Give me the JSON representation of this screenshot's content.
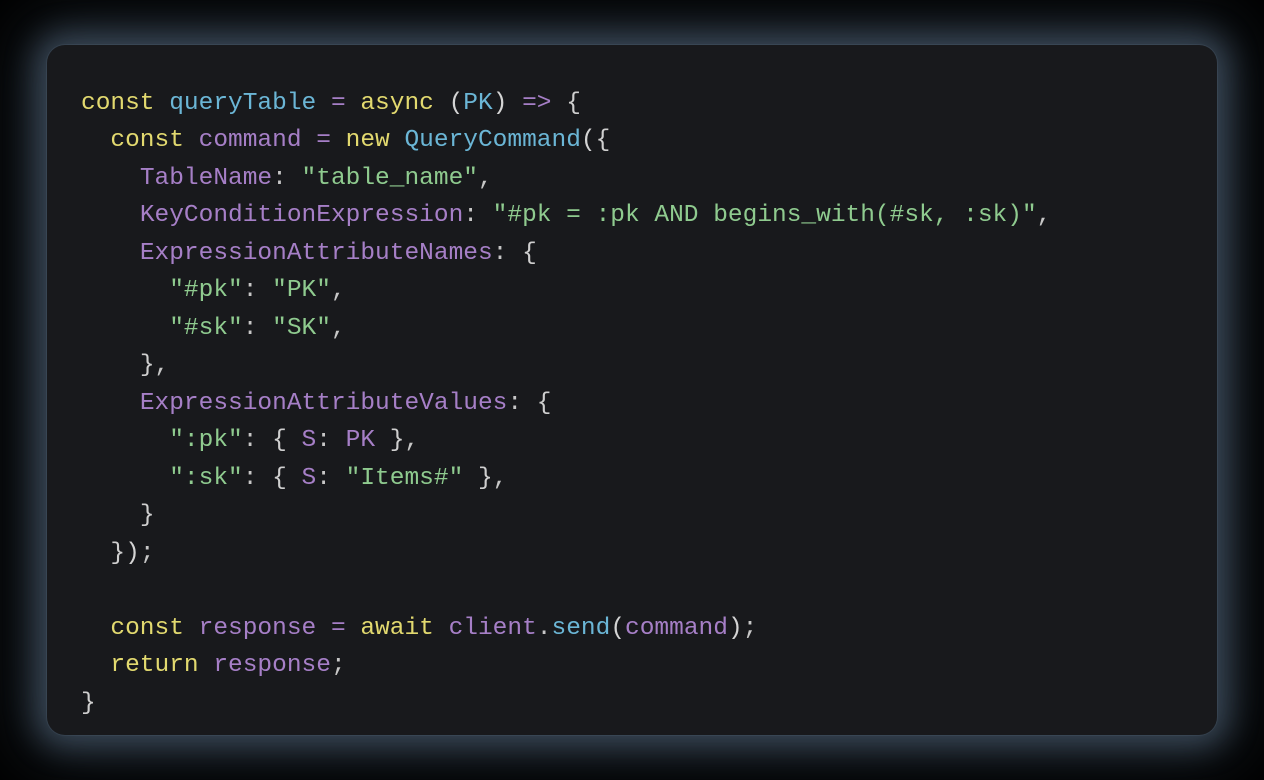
{
  "code": {
    "kw_const": "const",
    "fn_name": "queryTable",
    "eq": "=",
    "kw_async": "async",
    "lparen": "(",
    "param_pk": "PK",
    "rparen": ")",
    "arrow": "=>",
    "lbrace": "{",
    "rbrace": "}",
    "kw_const2": "const",
    "var_command": "command",
    "eq2": "=",
    "kw_new": "new",
    "type_querycmd": "QueryCommand",
    "lparen2": "(",
    "lbrace2": "{",
    "prop_tablename": "TableName",
    "colon": ":",
    "str_tablename": "\"table_name\"",
    "comma": ",",
    "prop_keycond": "KeyConditionExpression",
    "str_keycond": "\"#pk = :pk AND begins_with(#sk, :sk)\"",
    "prop_exprattrnames": "ExpressionAttributeNames",
    "str_hashpk": "\"#pk\"",
    "str_pk": "\"PK\"",
    "str_hashsk": "\"#sk\"",
    "str_sk": "\"SK\"",
    "prop_exprattrvalues": "ExpressionAttributeValues",
    "str_colonpk": "\":pk\"",
    "prop_s": "S",
    "ident_pk": "PK",
    "str_colonsk": "\":sk\"",
    "str_items": "\"Items#\"",
    "rparen2": ")",
    "semi": ";",
    "kw_const3": "const",
    "var_response": "response",
    "eq3": "=",
    "kw_await": "await",
    "ident_client": "client",
    "dot": ".",
    "method_send": "send",
    "lparen3": "(",
    "arg_command": "command",
    "rparen3": ")",
    "kw_return": "return",
    "ident_response": "response"
  }
}
